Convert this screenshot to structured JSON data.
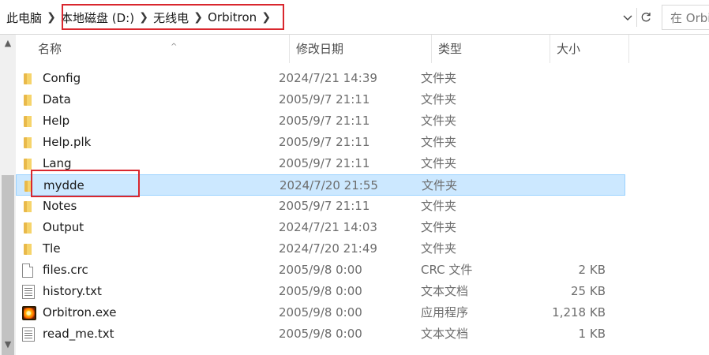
{
  "address": {
    "breadcrumbs": [
      "此电脑",
      "本地磁盘 (D:)",
      "无线电",
      "Orbitron"
    ],
    "separator": ">",
    "search_placeholder": "在 Orbi"
  },
  "columns": {
    "name": "名称",
    "date": "修改日期",
    "type": "类型",
    "size": "大小"
  },
  "files": [
    {
      "icon": "folder-icon",
      "name": "Config",
      "date": "2024/7/21 14:39",
      "type": "文件夹",
      "size": "",
      "selected": false
    },
    {
      "icon": "folder-icon",
      "name": "Data",
      "date": "2005/9/7 21:11",
      "type": "文件夹",
      "size": "",
      "selected": false
    },
    {
      "icon": "folder-icon",
      "name": "Help",
      "date": "2005/9/7 21:11",
      "type": "文件夹",
      "size": "",
      "selected": false
    },
    {
      "icon": "folder-icon",
      "name": "Help.plk",
      "date": "2005/9/7 21:11",
      "type": "文件夹",
      "size": "",
      "selected": false
    },
    {
      "icon": "folder-icon",
      "name": "Lang",
      "date": "2005/9/7 21:11",
      "type": "文件夹",
      "size": "",
      "selected": false
    },
    {
      "icon": "folder-icon",
      "name": "mydde",
      "date": "2024/7/20 21:55",
      "type": "文件夹",
      "size": "",
      "selected": true
    },
    {
      "icon": "folder-icon",
      "name": "Notes",
      "date": "2005/9/7 21:11",
      "type": "文件夹",
      "size": "",
      "selected": false
    },
    {
      "icon": "folder-icon",
      "name": "Output",
      "date": "2024/7/21 14:03",
      "type": "文件夹",
      "size": "",
      "selected": false
    },
    {
      "icon": "folder-icon",
      "name": "Tle",
      "date": "2024/7/20 21:49",
      "type": "文件夹",
      "size": "",
      "selected": false
    },
    {
      "icon": "file-icon",
      "name": "files.crc",
      "date": "2005/9/8 0:00",
      "type": "CRC 文件",
      "size": "2 KB",
      "selected": false
    },
    {
      "icon": "text-file-icon",
      "name": "history.txt",
      "date": "2005/9/8 0:00",
      "type": "文本文档",
      "size": "25 KB",
      "selected": false
    },
    {
      "icon": "orbitron-exe-icon",
      "name": "Orbitron.exe",
      "date": "2005/9/8 0:00",
      "type": "应用程序",
      "size": "1,218 KB",
      "selected": false
    },
    {
      "icon": "text-file-icon",
      "name": "read_me.txt",
      "date": "2005/9/8 0:00",
      "type": "文本文档",
      "size": "1 KB",
      "selected": false
    }
  ],
  "colors": {
    "highlight_red": "#d9272e",
    "selection_bg": "#cce8ff",
    "folder_yellow": "#f6d46b"
  }
}
